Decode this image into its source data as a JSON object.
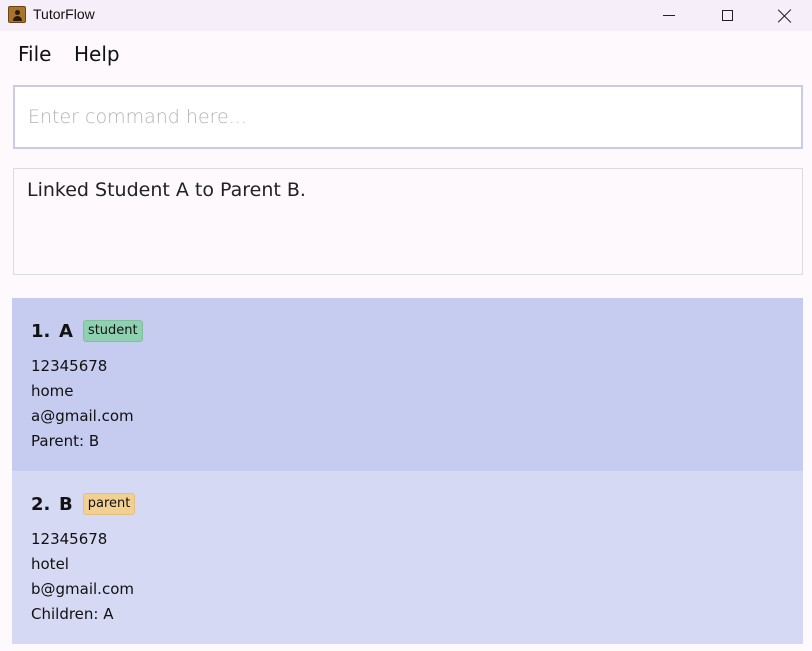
{
  "window": {
    "title": "TutorFlow"
  },
  "menu": {
    "file": "File",
    "help": "Help"
  },
  "command": {
    "placeholder": "Enter command here...",
    "value": ""
  },
  "result": {
    "text": "Linked Student A to Parent B."
  },
  "persons": [
    {
      "index": "1.",
      "name": "A",
      "tag": "student",
      "tag_color": "#8fd0b0",
      "phone": "12345678",
      "address": "home",
      "email": "a@gmail.com",
      "relation": "Parent: B"
    },
    {
      "index": "2.",
      "name": "B",
      "tag": "parent",
      "tag_color": "#f1d092",
      "phone": "12345678",
      "address": "hotel",
      "email": "b@gmail.com",
      "relation": "Children: A"
    }
  ],
  "colors": {
    "selected_card": "#c6cbf0",
    "card": "#d6d9f3",
    "command_border": "#c9cbe9"
  }
}
